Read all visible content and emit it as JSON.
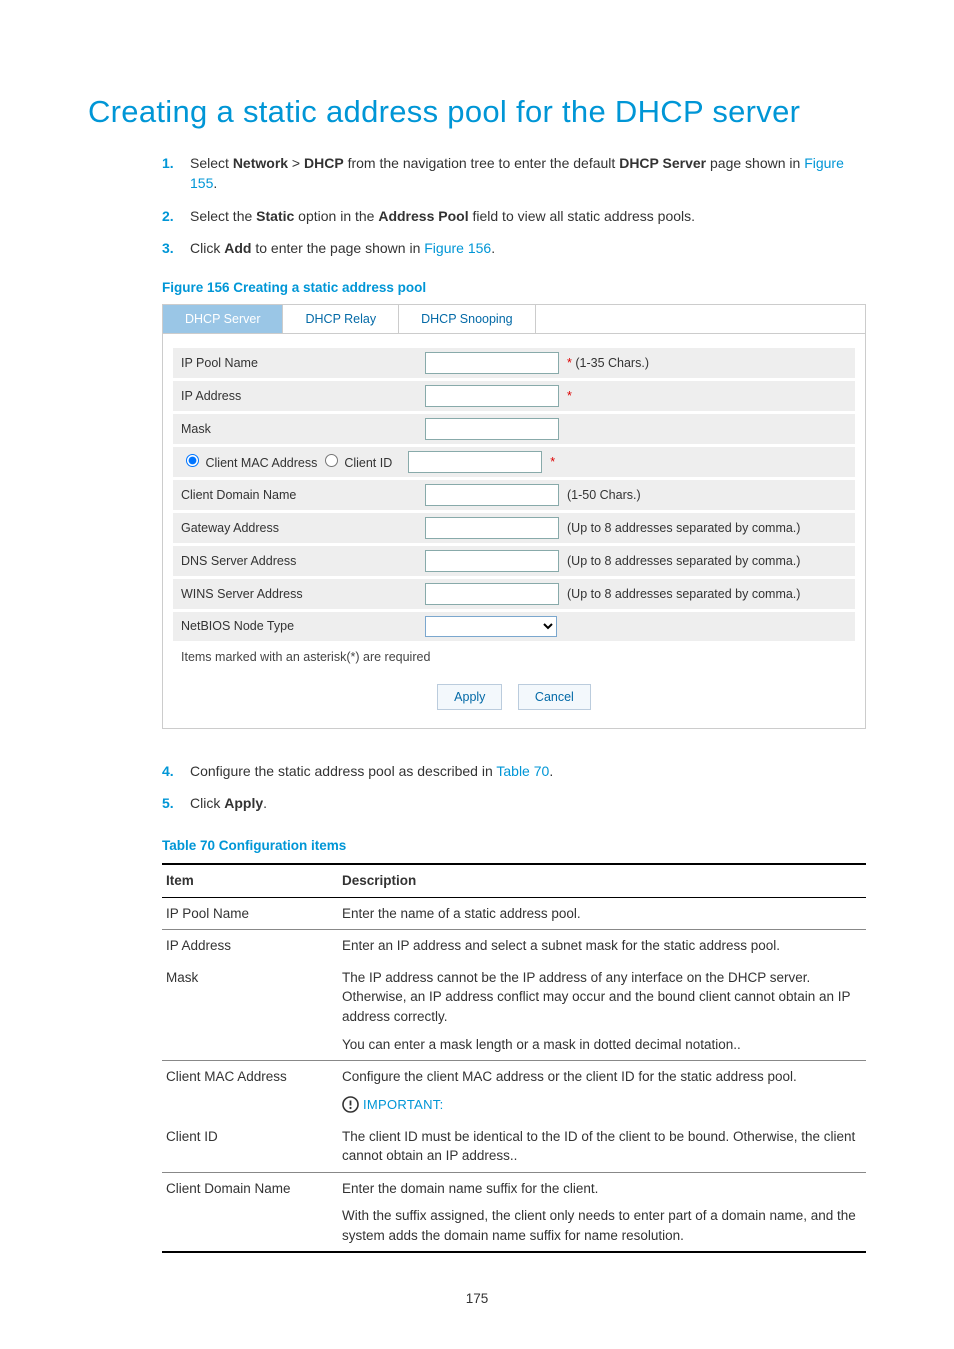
{
  "title": "Creating a static address pool for the DHCP server",
  "steps": {
    "s1a": "Select ",
    "s1b": "Network",
    "s1c": " > ",
    "s1d": "DHCP",
    "s1e": " from the navigation tree to enter the default ",
    "s1f": "DHCP Server",
    "s1g": " page shown in ",
    "s1link": "Figure 155",
    "s1end": ".",
    "s2a": "Select the ",
    "s2b": "Static",
    "s2c": " option in the ",
    "s2d": "Address Pool",
    "s2e": " field to view all static address pools.",
    "s3a": "Click ",
    "s3b": "Add",
    "s3c": " to enter the page shown in ",
    "s3link": "Figure 156",
    "s3end": ".",
    "s4a": "Configure the static address pool as described in ",
    "s4link": "Table 70",
    "s4end": ".",
    "s5a": "Click ",
    "s5b": "Apply",
    "s5end": "."
  },
  "figCaption": "Figure 156 Creating a static address pool",
  "tblCaption": "Table 70 Configuration items",
  "ui": {
    "tabs": {
      "t1": "DHCP Server",
      "t2": "DHCP Relay",
      "t3": "DHCP Snooping"
    },
    "rows": {
      "poolName": "IP Pool Name",
      "poolHint": " (1-35 Chars.)",
      "ip": "IP Address",
      "mask": "Mask",
      "macRadio": "Client MAC Address",
      "idRadio": "Client ID",
      "domain": "Client Domain Name",
      "domainHint": "(1-50 Chars.)",
      "gw": "Gateway Address",
      "gwHint": "(Up to 8 addresses separated by comma.)",
      "dns": "DNS Server Address",
      "dnsHint": "(Up to 8 addresses separated by comma.)",
      "wins": "WINS Server Address",
      "winsHint": "(Up to 8 addresses separated by comma.)",
      "nb": "NetBIOS Node Type"
    },
    "note": "Items marked with an asterisk(*) are required",
    "apply": "Apply",
    "cancel": "Cancel",
    "star": "*"
  },
  "table": {
    "hItem": "Item",
    "hDesc": "Description",
    "r1i": "IP Pool Name",
    "r1d": "Enter the name of a static address pool.",
    "r2i": "IP Address",
    "r2d": "Enter an IP address and select a subnet mask for the static address pool.",
    "r3i": "Mask",
    "r3d1": "The IP address cannot be the IP address of any interface on the DHCP server. Otherwise, an IP address conflict may occur and the bound client cannot obtain an IP address correctly.",
    "r3d2": "You can enter a mask length or a mask in dotted decimal notation..",
    "r4i": "Client MAC Address",
    "r4d": "Configure the client MAC address or the client ID for the static address pool.",
    "imp": "IMPORTANT:",
    "r5i": "Client ID",
    "r5d": "The client ID must be identical to the ID of the client to be bound. Otherwise, the client cannot obtain an IP address..",
    "r6i": "Client Domain Name",
    "r6d1": "Enter the domain name suffix for the client.",
    "r6d2": "With the suffix assigned, the client only needs to enter part of a domain name, and the system adds the domain name suffix for name resolution."
  },
  "pageNum": "175"
}
